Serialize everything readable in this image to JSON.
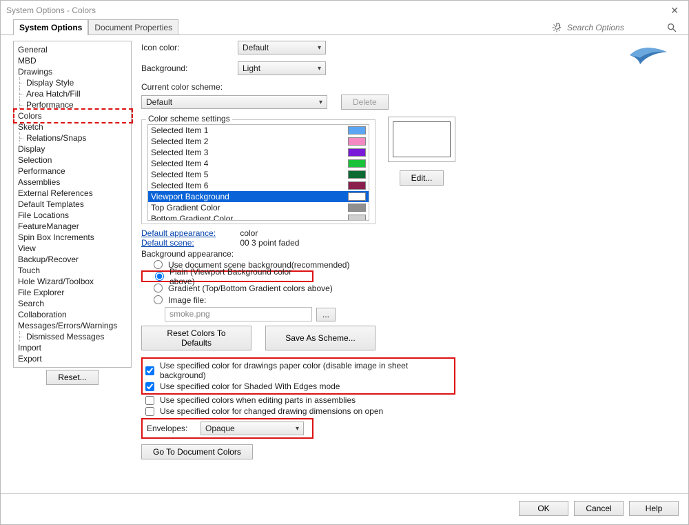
{
  "window": {
    "title": "System Options - Colors"
  },
  "tabs": {
    "system_options": "System Options",
    "document_properties": "Document Properties"
  },
  "search": {
    "placeholder": "Search Options"
  },
  "nav": [
    {
      "label": "General",
      "sub": false
    },
    {
      "label": "MBD",
      "sub": false
    },
    {
      "label": "Drawings",
      "sub": false
    },
    {
      "label": "Display Style",
      "sub": true
    },
    {
      "label": "Area Hatch/Fill",
      "sub": true
    },
    {
      "label": "Performance",
      "sub": true
    },
    {
      "label": "Colors",
      "sub": false,
      "active": true
    },
    {
      "label": "Sketch",
      "sub": false
    },
    {
      "label": "Relations/Snaps",
      "sub": true
    },
    {
      "label": "Display",
      "sub": false
    },
    {
      "label": "Selection",
      "sub": false
    },
    {
      "label": "Performance",
      "sub": false
    },
    {
      "label": "Assemblies",
      "sub": false
    },
    {
      "label": "External References",
      "sub": false
    },
    {
      "label": "Default Templates",
      "sub": false
    },
    {
      "label": "File Locations",
      "sub": false
    },
    {
      "label": "FeatureManager",
      "sub": false
    },
    {
      "label": "Spin Box Increments",
      "sub": false
    },
    {
      "label": "View",
      "sub": false
    },
    {
      "label": "Backup/Recover",
      "sub": false
    },
    {
      "label": "Touch",
      "sub": false
    },
    {
      "label": "Hole Wizard/Toolbox",
      "sub": false
    },
    {
      "label": "File Explorer",
      "sub": false
    },
    {
      "label": "Search",
      "sub": false
    },
    {
      "label": "Collaboration",
      "sub": false
    },
    {
      "label": "Messages/Errors/Warnings",
      "sub": false
    },
    {
      "label": "Dismissed Messages",
      "sub": true
    },
    {
      "label": "Import",
      "sub": false
    },
    {
      "label": "Export",
      "sub": false
    }
  ],
  "reset_btn": "Reset...",
  "labels": {
    "icon_color": "Icon color:",
    "background": "Background:",
    "current_scheme": "Current color scheme:",
    "scheme_settings": "Color scheme settings",
    "default_appearance": "Default appearance:",
    "default_appearance_val": "color",
    "default_scene": "Default scene:",
    "default_scene_val": "00 3 point faded",
    "bg_appearance": "Background appearance:",
    "radio1": "Use document scene background(recommended)",
    "radio2": "Plain (Viewport Background color above)",
    "radio3": "Gradient (Top/Bottom Gradient colors above)",
    "radio4": "Image file:",
    "imgfile": "smoke.png",
    "reset_colors": "Reset Colors To Defaults",
    "save_scheme": "Save As Scheme...",
    "cb1": "Use specified color for drawings paper color (disable image in sheet background)",
    "cb2": "Use specified color for Shaded With Edges mode",
    "cb3": "Use specified colors when editing parts in assemblies",
    "cb4": "Use specified color for changed drawing dimensions on open",
    "envelopes": "Envelopes:",
    "goto": "Go To Document Colors",
    "delete": "Delete",
    "edit": "Edit..."
  },
  "dropdowns": {
    "icon_color": "Default",
    "background": "Light",
    "scheme": "Default",
    "envelopes": "Opaque"
  },
  "scheme_items": [
    {
      "name": "Selected Item 1",
      "color": "#5aa6f5"
    },
    {
      "name": "Selected Item 2",
      "color": "#f488c2"
    },
    {
      "name": "Selected Item 3",
      "color": "#7a18d8"
    },
    {
      "name": "Selected Item 4",
      "color": "#19c23a"
    },
    {
      "name": "Selected Item 5",
      "color": "#0c6b33"
    },
    {
      "name": "Selected Item 6",
      "color": "#8a1f4d"
    },
    {
      "name": "Viewport Background",
      "color": "#ffffff",
      "selected": true
    },
    {
      "name": "Top Gradient Color",
      "color": "#8f8f8f"
    },
    {
      "name": "Bottom Gradient Color",
      "color": "#d0d0d0"
    }
  ],
  "footer": {
    "ok": "OK",
    "cancel": "Cancel",
    "help": "Help"
  }
}
